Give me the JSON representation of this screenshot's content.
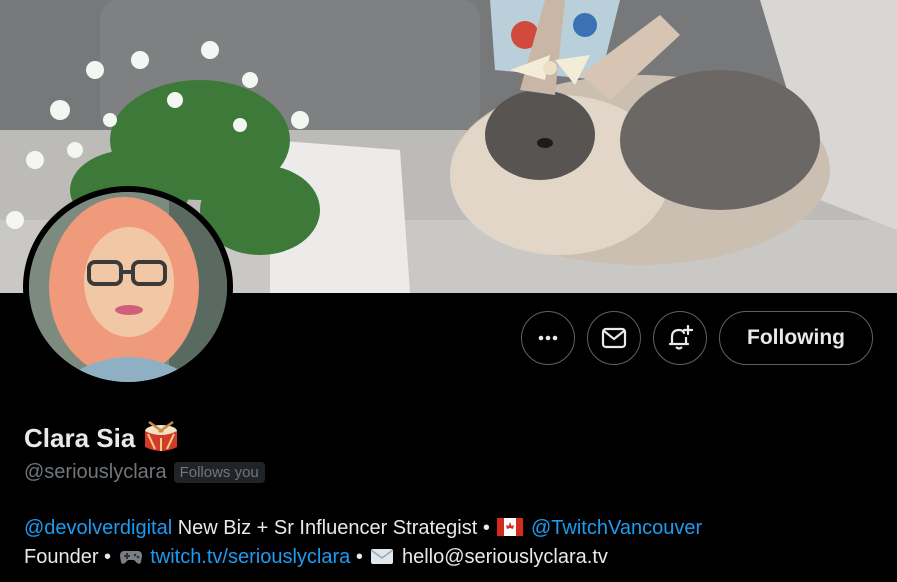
{
  "profile": {
    "display_name": "Clara Sia",
    "name_emoji": "drum",
    "handle": "@seriouslyclara",
    "follows_you_badge": "Follows you"
  },
  "actions": {
    "more_icon": "more-horizontal-icon",
    "message_icon": "envelope-icon",
    "notify_icon": "bell-plus-icon",
    "follow_label": "Following"
  },
  "bio": {
    "line1_mention": "@devolverdigital",
    "line1_text": "New Biz + Sr Influencer Strategist •",
    "line1_flag": "canada-flag",
    "line1_mention2": "@TwitchVancouver",
    "line2_text1": "Founder •",
    "line2_icon": "gamepad-emoji",
    "line2_link": "twitch.tv/seriouslyclara",
    "line2_sep": "•",
    "line2_icon2": "envelope-emoji",
    "line2_email": "hello@seriouslyclara.tv"
  },
  "colors": {
    "background": "#000000",
    "text": "#e7e9ea",
    "muted": "#71767b",
    "link": "#1d9bf0",
    "border": "#536471"
  }
}
